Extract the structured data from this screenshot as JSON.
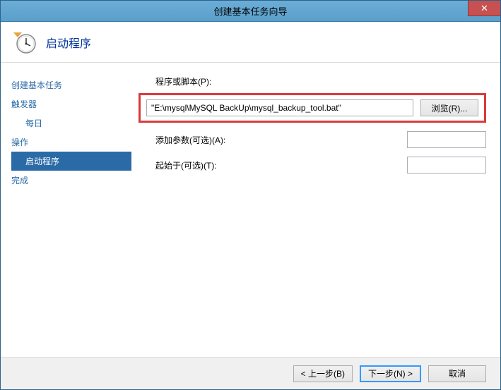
{
  "window": {
    "title": "创建基本任务向导"
  },
  "header": {
    "title": "启动程序"
  },
  "sidebar": {
    "items": [
      {
        "label": "创建基本任务"
      },
      {
        "label": "触发器"
      },
      {
        "label": "每日"
      },
      {
        "label": "操作"
      },
      {
        "label": "启动程序"
      },
      {
        "label": "完成"
      }
    ]
  },
  "form": {
    "script_label": "程序或脚本(P):",
    "script_value": "\"E:\\mysql\\MySQL BackUp\\mysql_backup_tool.bat\"",
    "browse_label": "浏览(R)...",
    "args_label": "添加参数(可选)(A):",
    "args_value": "",
    "startin_label": "起始于(可选)(T):",
    "startin_value": ""
  },
  "footer": {
    "back": "< 上一步(B)",
    "next": "下一步(N) >",
    "cancel": "取消"
  }
}
